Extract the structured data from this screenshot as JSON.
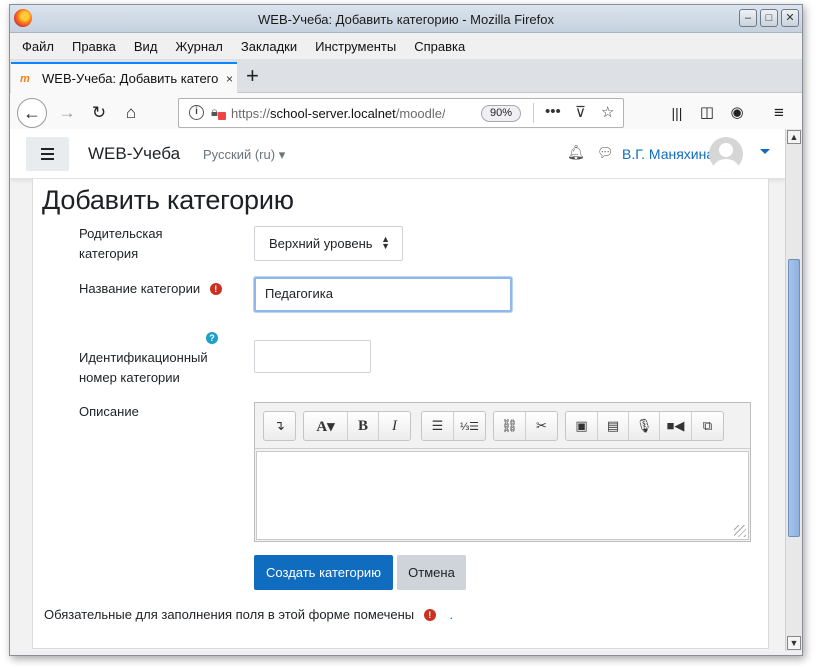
{
  "window": {
    "title": "WEB-Учеба: Добавить категорию - Mozilla Firefox",
    "controls": [
      "minimize",
      "maximize",
      "close"
    ]
  },
  "menubar": [
    "Файл",
    "Правка",
    "Вид",
    "Журнал",
    "Закладки",
    "Инструменты",
    "Справка"
  ],
  "tab": {
    "label": "WEB-Учеба: Добавить катего",
    "close": "×"
  },
  "newtab": "+",
  "urlbar": {
    "url_prefix": "https://",
    "url_host": "school-server.localnet",
    "url_path": "/moodle/",
    "zoom": "90%"
  },
  "site_nav": {
    "brand": "WEB-Учеба",
    "language": "Русский (ru)",
    "user_name": "В.Г. Маняхина"
  },
  "page": {
    "title": "Добавить категорию",
    "fields": {
      "parent_label_line1": "Родительская",
      "parent_label_line2": "категория",
      "parent_value": "Верхний уровень",
      "name_label": "Название категории",
      "name_value": "Педагогика",
      "idnumber_label_line1": "Идентификационный",
      "idnumber_label_line2": "номер категории",
      "description_label": "Описание"
    },
    "buttons": {
      "submit": "Создать категорию",
      "cancel": "Отмена"
    },
    "required_note": "Обязательные для заполнения поля в этой форме помечены",
    "required_note_end": "."
  },
  "colors": {
    "primary": "#0f6cbf",
    "required": "#ca3120",
    "help": "#1f9fc8",
    "secondary_button": "#ced4da"
  }
}
